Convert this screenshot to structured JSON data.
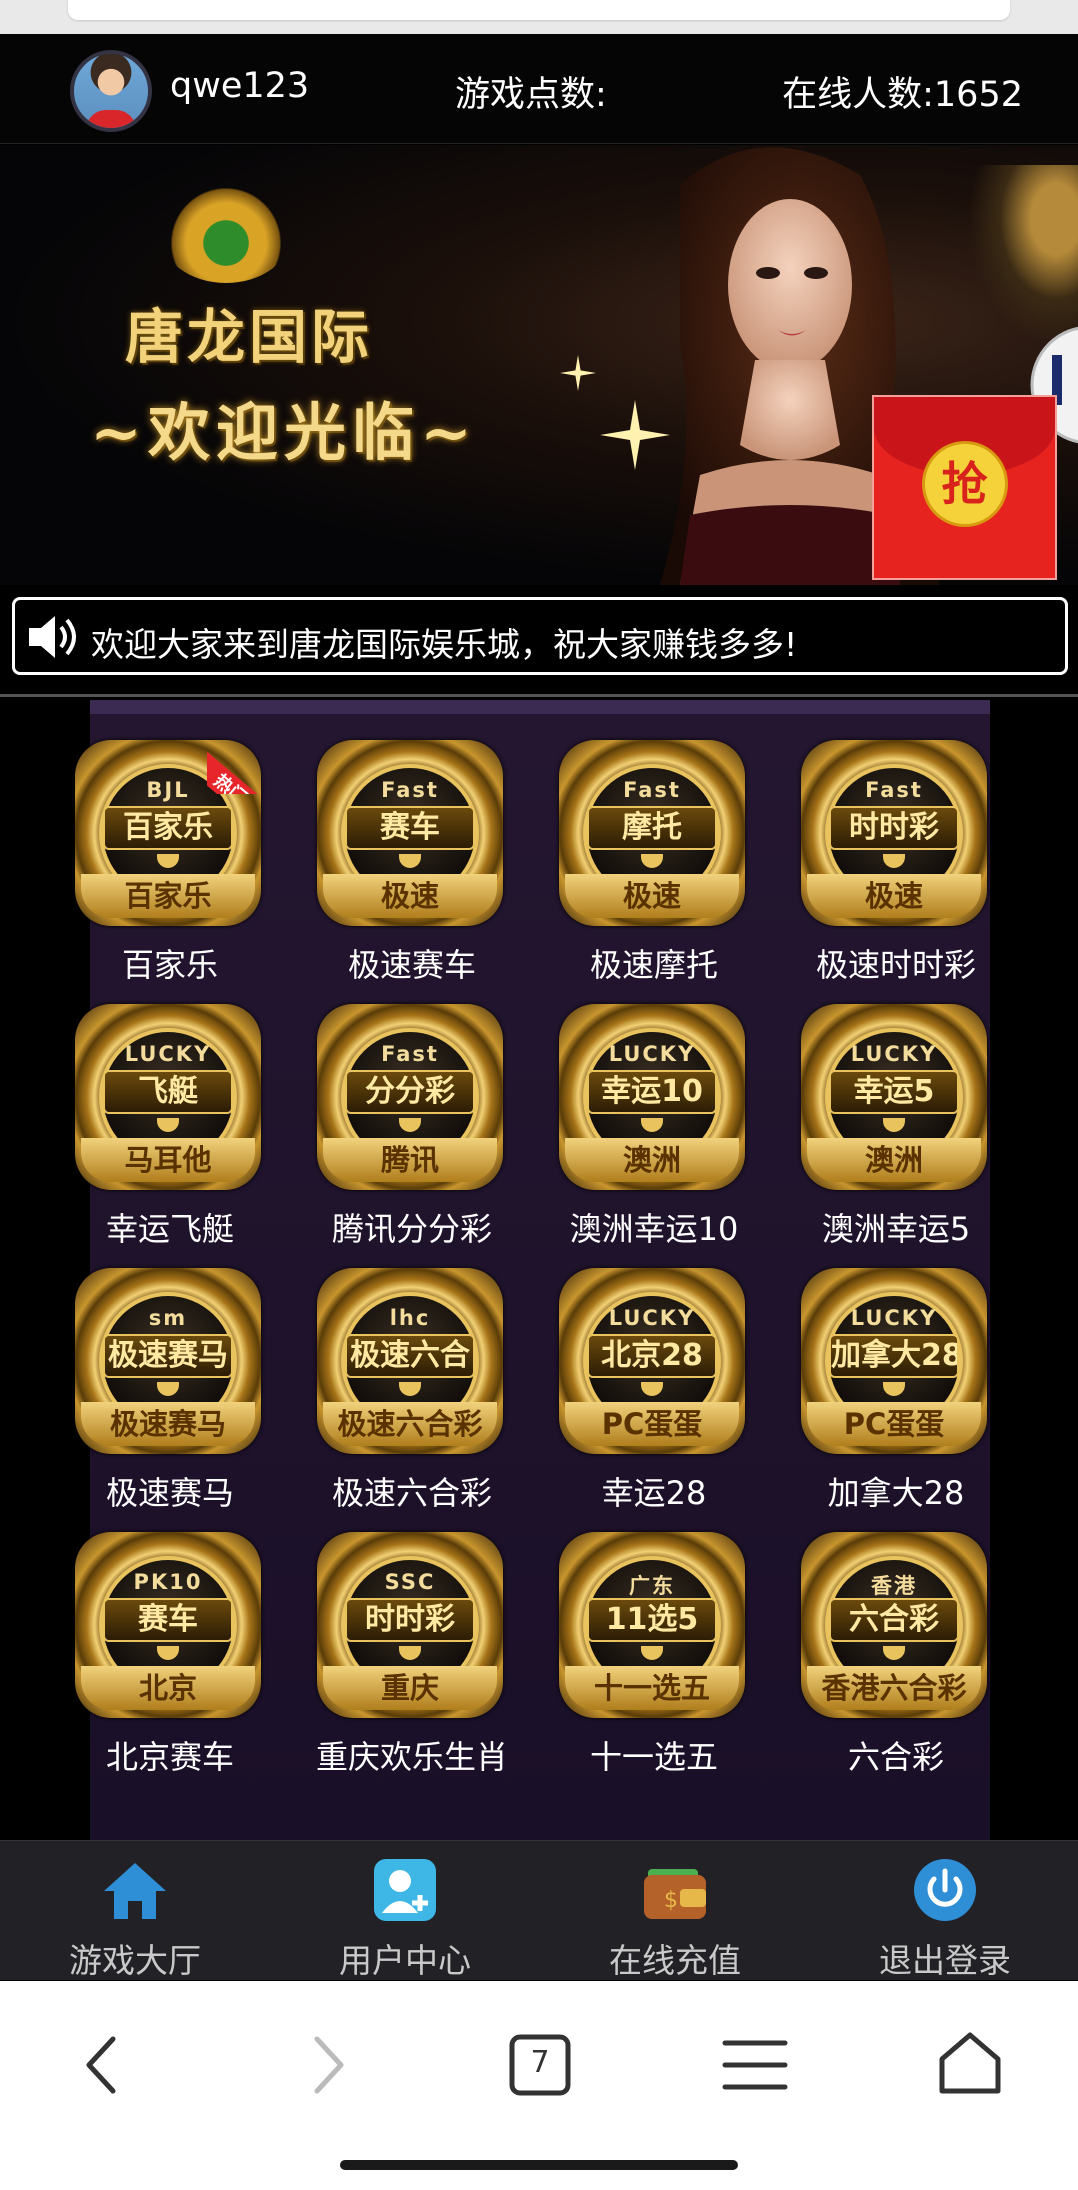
{
  "header": {
    "username": "qwe123",
    "points_label": "游戏点数:",
    "online_label": "在线人数:1652"
  },
  "banner": {
    "brand": "唐龙国际",
    "welcome": "~欢迎光临~",
    "red_packet_label": "抢"
  },
  "notice": {
    "text": "欢迎大家来到唐龙国际娱乐城，祝大家赚钱多多!"
  },
  "games": [
    {
      "label": "百家乐",
      "top": "BJL",
      "mid": "百家乐",
      "bottom": "百家乐",
      "hot": "热门"
    },
    {
      "label": "极速赛车",
      "top": "Fast",
      "mid": "赛车",
      "bottom": "极速"
    },
    {
      "label": "极速摩托",
      "top": "Fast",
      "mid": "摩托",
      "bottom": "极速"
    },
    {
      "label": "极速时时彩",
      "top": "Fast",
      "mid": "时时彩",
      "bottom": "极速"
    },
    {
      "label": "幸运飞艇",
      "top": "LUCKY",
      "mid": "飞艇",
      "bottom": "马耳他"
    },
    {
      "label": "腾讯分分彩",
      "top": "Fast",
      "mid": "分分彩",
      "bottom": "腾讯"
    },
    {
      "label": "澳洲幸运10",
      "top": "LUCKY",
      "mid": "幸运10",
      "bottom": "澳洲"
    },
    {
      "label": "澳洲幸运5",
      "top": "LUCKY",
      "mid": "幸运5",
      "bottom": "澳洲"
    },
    {
      "label": "极速赛马",
      "top": "sm",
      "mid": "极速赛马",
      "bottom": "极速赛马"
    },
    {
      "label": "极速六合彩",
      "top": "lhc",
      "mid": "极速六合",
      "bottom": "极速六合彩"
    },
    {
      "label": "幸运28",
      "top": "LUCKY",
      "mid": "北京28",
      "bottom": "PC蛋蛋"
    },
    {
      "label": "加拿大28",
      "top": "LUCKY",
      "mid": "加拿大28",
      "bottom": "PC蛋蛋"
    },
    {
      "label": "北京赛车",
      "top": "PK10",
      "mid": "赛车",
      "bottom": "北京"
    },
    {
      "label": "重庆欢乐生肖",
      "top": "SSC",
      "mid": "时时彩",
      "bottom": "重庆"
    },
    {
      "label": "十一选五",
      "top": "广东",
      "mid": "11选5",
      "bottom": "十一选五"
    },
    {
      "label": "六合彩",
      "top": "香港",
      "mid": "六合彩",
      "bottom": "香港六合彩"
    }
  ],
  "nav": [
    {
      "label": "游戏大厅",
      "icon": "home-icon"
    },
    {
      "label": "用户中心",
      "icon": "user-add-icon"
    },
    {
      "label": "在线充值",
      "icon": "wallet-icon"
    },
    {
      "label": "退出登录",
      "icon": "power-icon"
    }
  ],
  "browser": {
    "tab_count": "7"
  },
  "colors": {
    "accent_gold": "#e8c35e",
    "red_packet": "#e7231f",
    "nav_blue": "#2f8fd6"
  }
}
